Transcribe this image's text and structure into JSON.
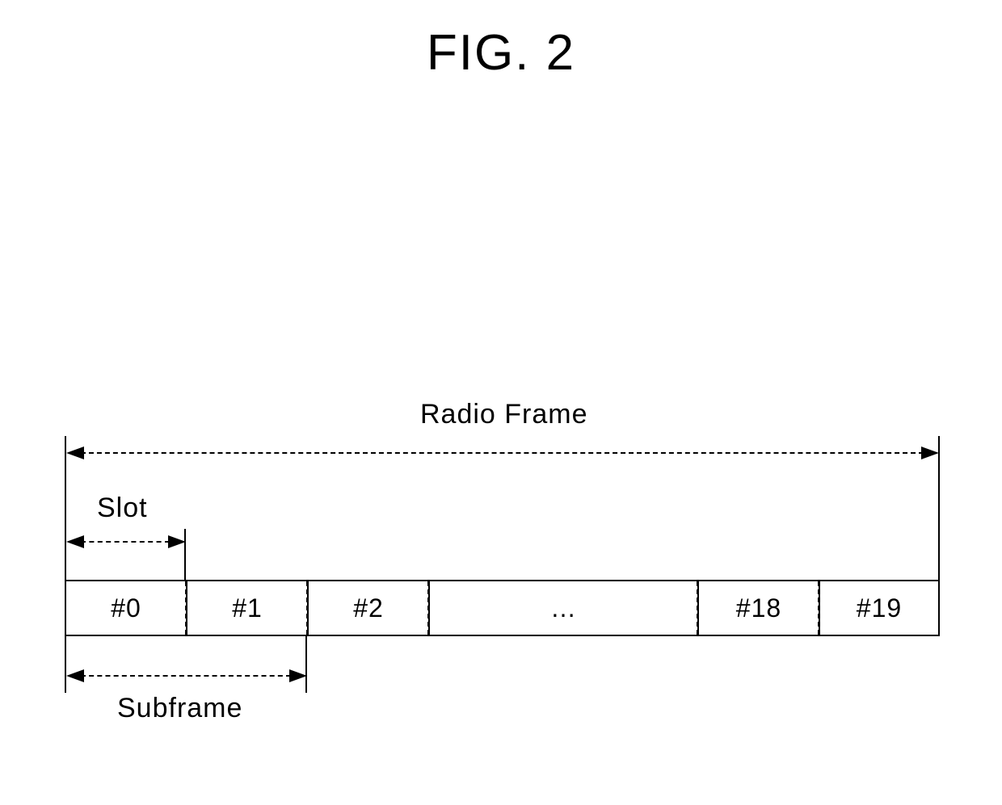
{
  "title": "FIG. 2",
  "labels": {
    "radio_frame": "Radio Frame",
    "slot": "Slot",
    "subframe": "Subframe"
  },
  "slots": {
    "s0": "#0",
    "s1": "#1",
    "s2": "#2",
    "ellipsis": "…",
    "s18": "#18",
    "s19": "#19"
  }
}
